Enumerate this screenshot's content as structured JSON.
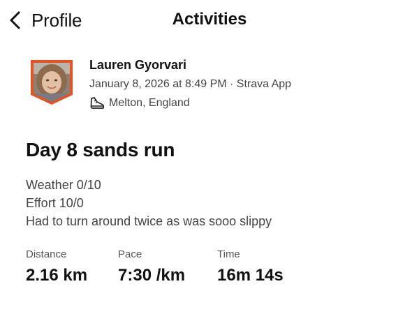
{
  "header": {
    "back_label": "Profile",
    "title": "Activities"
  },
  "athlete": {
    "name": "Lauren Gyorvari",
    "date_line": "January 8, 2026 at 8:49 PM · Strava App",
    "location": "Melton, England",
    "activity_icon": "shoe-icon"
  },
  "activity": {
    "title": "Day 8 sands run",
    "description": [
      "Weather 0/10",
      "Effort 10/0",
      "Had to turn around twice as was sooo slippy"
    ]
  },
  "stats": [
    {
      "label": "Distance",
      "value": "2.16 km"
    },
    {
      "label": "Pace",
      "value": "7:30 /km"
    },
    {
      "label": "Time",
      "value": "16m 14s"
    }
  ],
  "colors": {
    "avatar_border": "#E8521E",
    "text_primary": "#111111",
    "text_secondary": "#444444"
  }
}
